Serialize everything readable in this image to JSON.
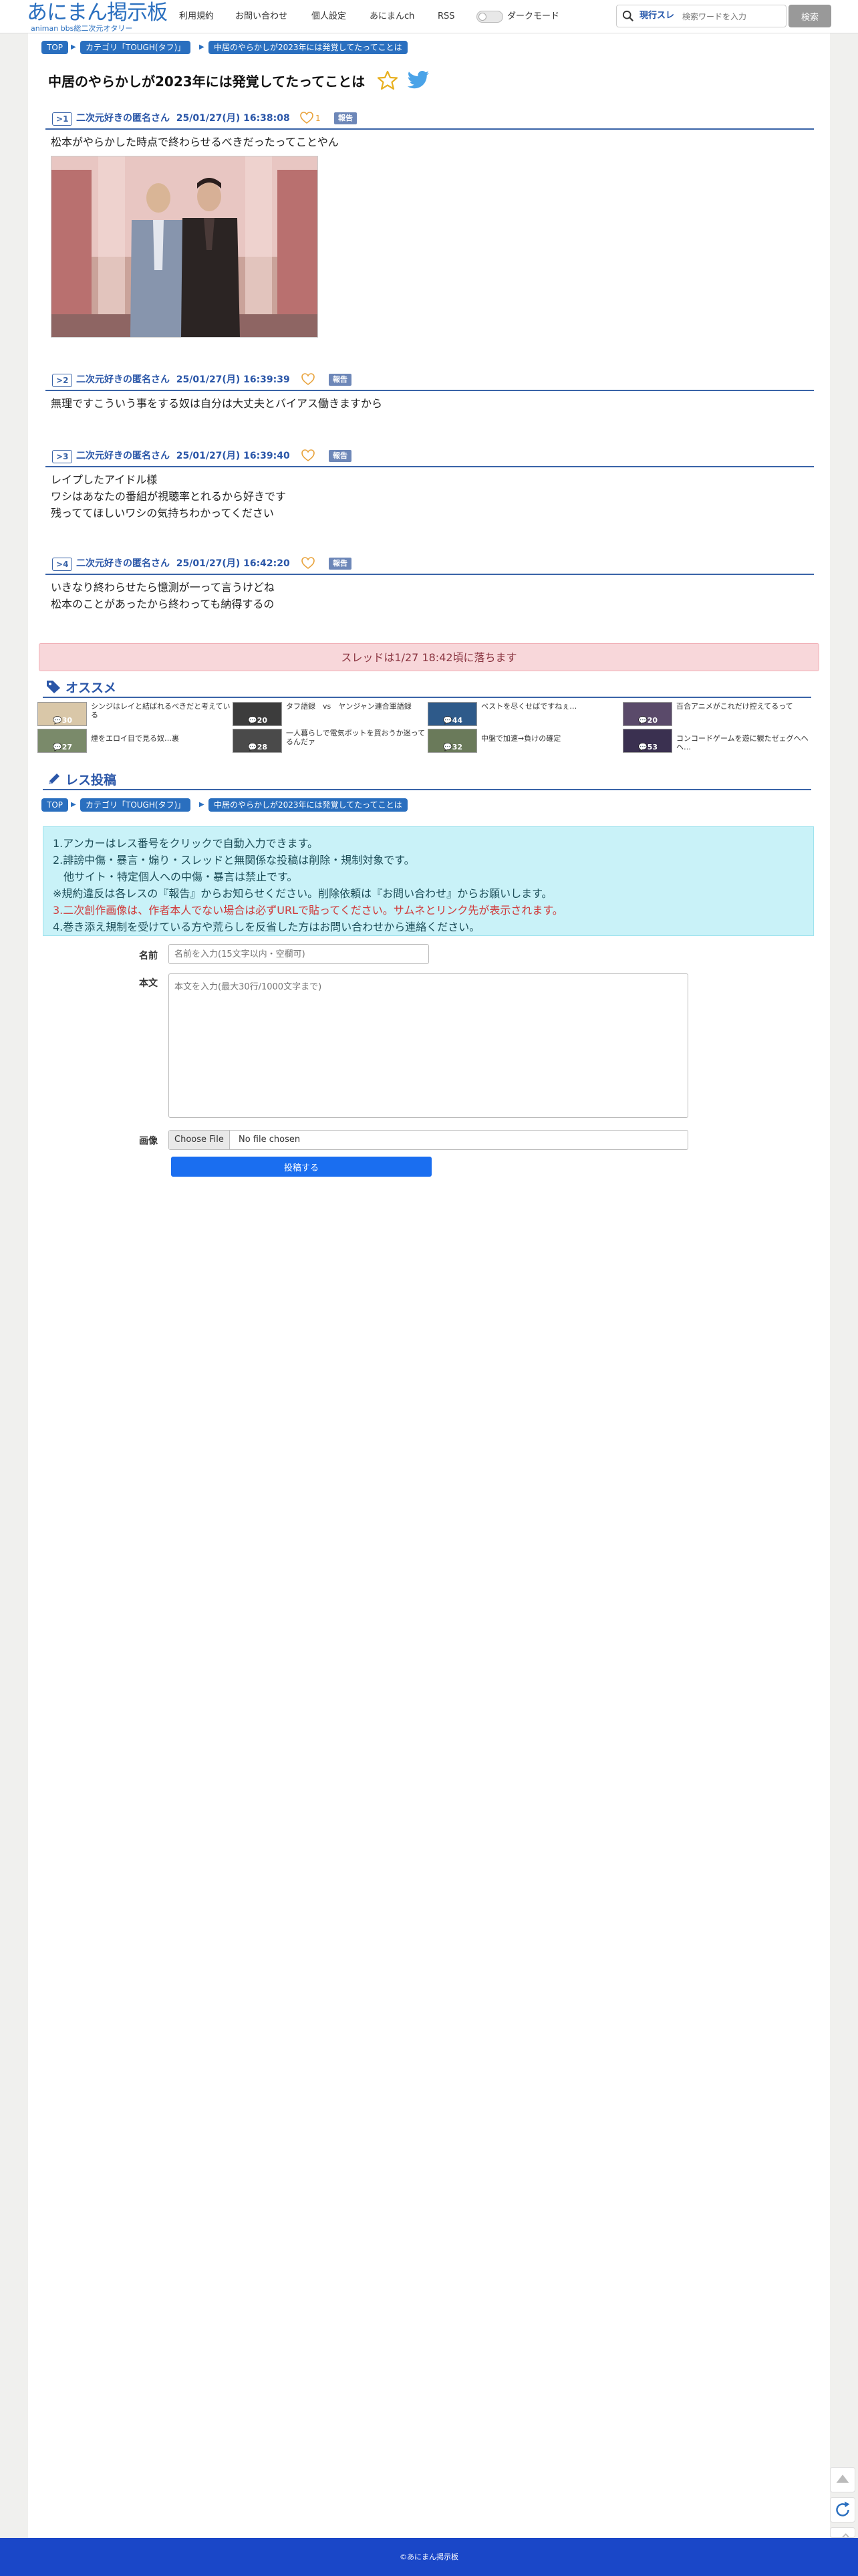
{
  "header": {
    "logo_main": "あにまん掲示板",
    "logo_sub": "animan bbs総二次元オタリー",
    "nav": [
      "利用規約",
      "お問い合わせ",
      "個人設定",
      "あにまんch",
      "RSS"
    ],
    "dark_mode_label": "ダークモード",
    "search_scope": "現行スレ",
    "search_placeholder": "検索ワードを入力",
    "search_button": "検索"
  },
  "breadcrumb": [
    "TOP",
    "カテゴリ「TOUGH(タフ)」",
    "中居のやらかしが2023年には発覚してたってことは"
  ],
  "thread": {
    "title": "中居のやらかしが2023年には発覚してたってことは"
  },
  "posts": [
    {
      "no": "1",
      "name": "二次元好きの匿名さん",
      "date": "25/01/27(月) 16:38:08",
      "likes": "1",
      "report": "報告",
      "lines": [
        "松本がやらかした時点で終わらせるべきだったってことやん"
      ],
      "has_image": true
    },
    {
      "no": "2",
      "name": "二次元好きの匿名さん",
      "date": "25/01/27(月) 16:39:39",
      "likes": "",
      "report": "報告",
      "lines": [
        "無理ですこういう事をする奴は自分は大丈夫とバイアス働きますから"
      ],
      "has_image": false
    },
    {
      "no": "3",
      "name": "二次元好きの匿名さん",
      "date": "25/01/27(月) 16:39:40",
      "likes": "",
      "report": "報告",
      "lines": [
        "レイプしたアイドル様",
        "ワシはあなたの番組が視聴率とれるから好きです",
        "残っててほしいワシの気持ちわかってください"
      ],
      "has_image": false
    },
    {
      "no": "4",
      "name": "二次元好きの匿名さん",
      "date": "25/01/27(月) 16:42:20",
      "likes": "",
      "report": "報告",
      "lines": [
        "いきなり終わらせたら憶測が一って言うけどね",
        "松本のことがあったから終わっても納得するの"
      ],
      "has_image": false
    }
  ],
  "expire_notice": "スレッドは1/27 18:42頃に落ちます",
  "recommend": {
    "title": "オススメ",
    "items": [
      {
        "title": "シンジはレイと結ばれるべきだと考えている",
        "count": "30"
      },
      {
        "title": "タフ語録　vs　ヤンジャン連合軍語録",
        "count": "20"
      },
      {
        "title": "ベストを尽くせばですねぇ…",
        "count": "44"
      },
      {
        "title": "百合アニメがこれだけ控えてるって",
        "count": "20"
      },
      {
        "title": "煙をエロイ目で見る奴…裏",
        "count": "27"
      },
      {
        "title": "一人暮らしで電気ポットを買おうか迷ってるんだァ",
        "count": "28"
      },
      {
        "title": "中盤で加速→負けの確定",
        "count": "32"
      },
      {
        "title": "コンコードゲームを遊に観たゼェグヘヘヘ…",
        "count": "53"
      }
    ]
  },
  "reply_form": {
    "title": "レス投稿",
    "rules": [
      "1.アンカーはレス番号をクリックで自動入力できます。",
      "2.誹謗中傷・暴言・煽り・スレッドと無関係な投稿は削除・規制対象です。",
      "　他サイト・特定個人への中傷・暴言は禁止です。",
      "※規約違反は各レスの『報告』からお知らせください。削除依頼は『お問い合わせ』からお願いします。",
      "3.二次創作画像は、作者本人でない場合は必ずURLで貼ってください。サムネとリンク先が表示されます。",
      "4.巻き添え規制を受けている方や荒らしを反省した方はお問い合わせから連絡ください。"
    ],
    "name_label": "名前",
    "name_placeholder": "名前を入力(15文字以内・空欄可)",
    "body_label": "本文",
    "body_placeholder": "本文を入力(最大30行/1000文字まで)",
    "image_label": "画像",
    "file_button": "Choose File",
    "file_status": "No file chosen",
    "submit": "投稿する"
  },
  "footer": {
    "copyright": "©あにまん掲示板"
  }
}
